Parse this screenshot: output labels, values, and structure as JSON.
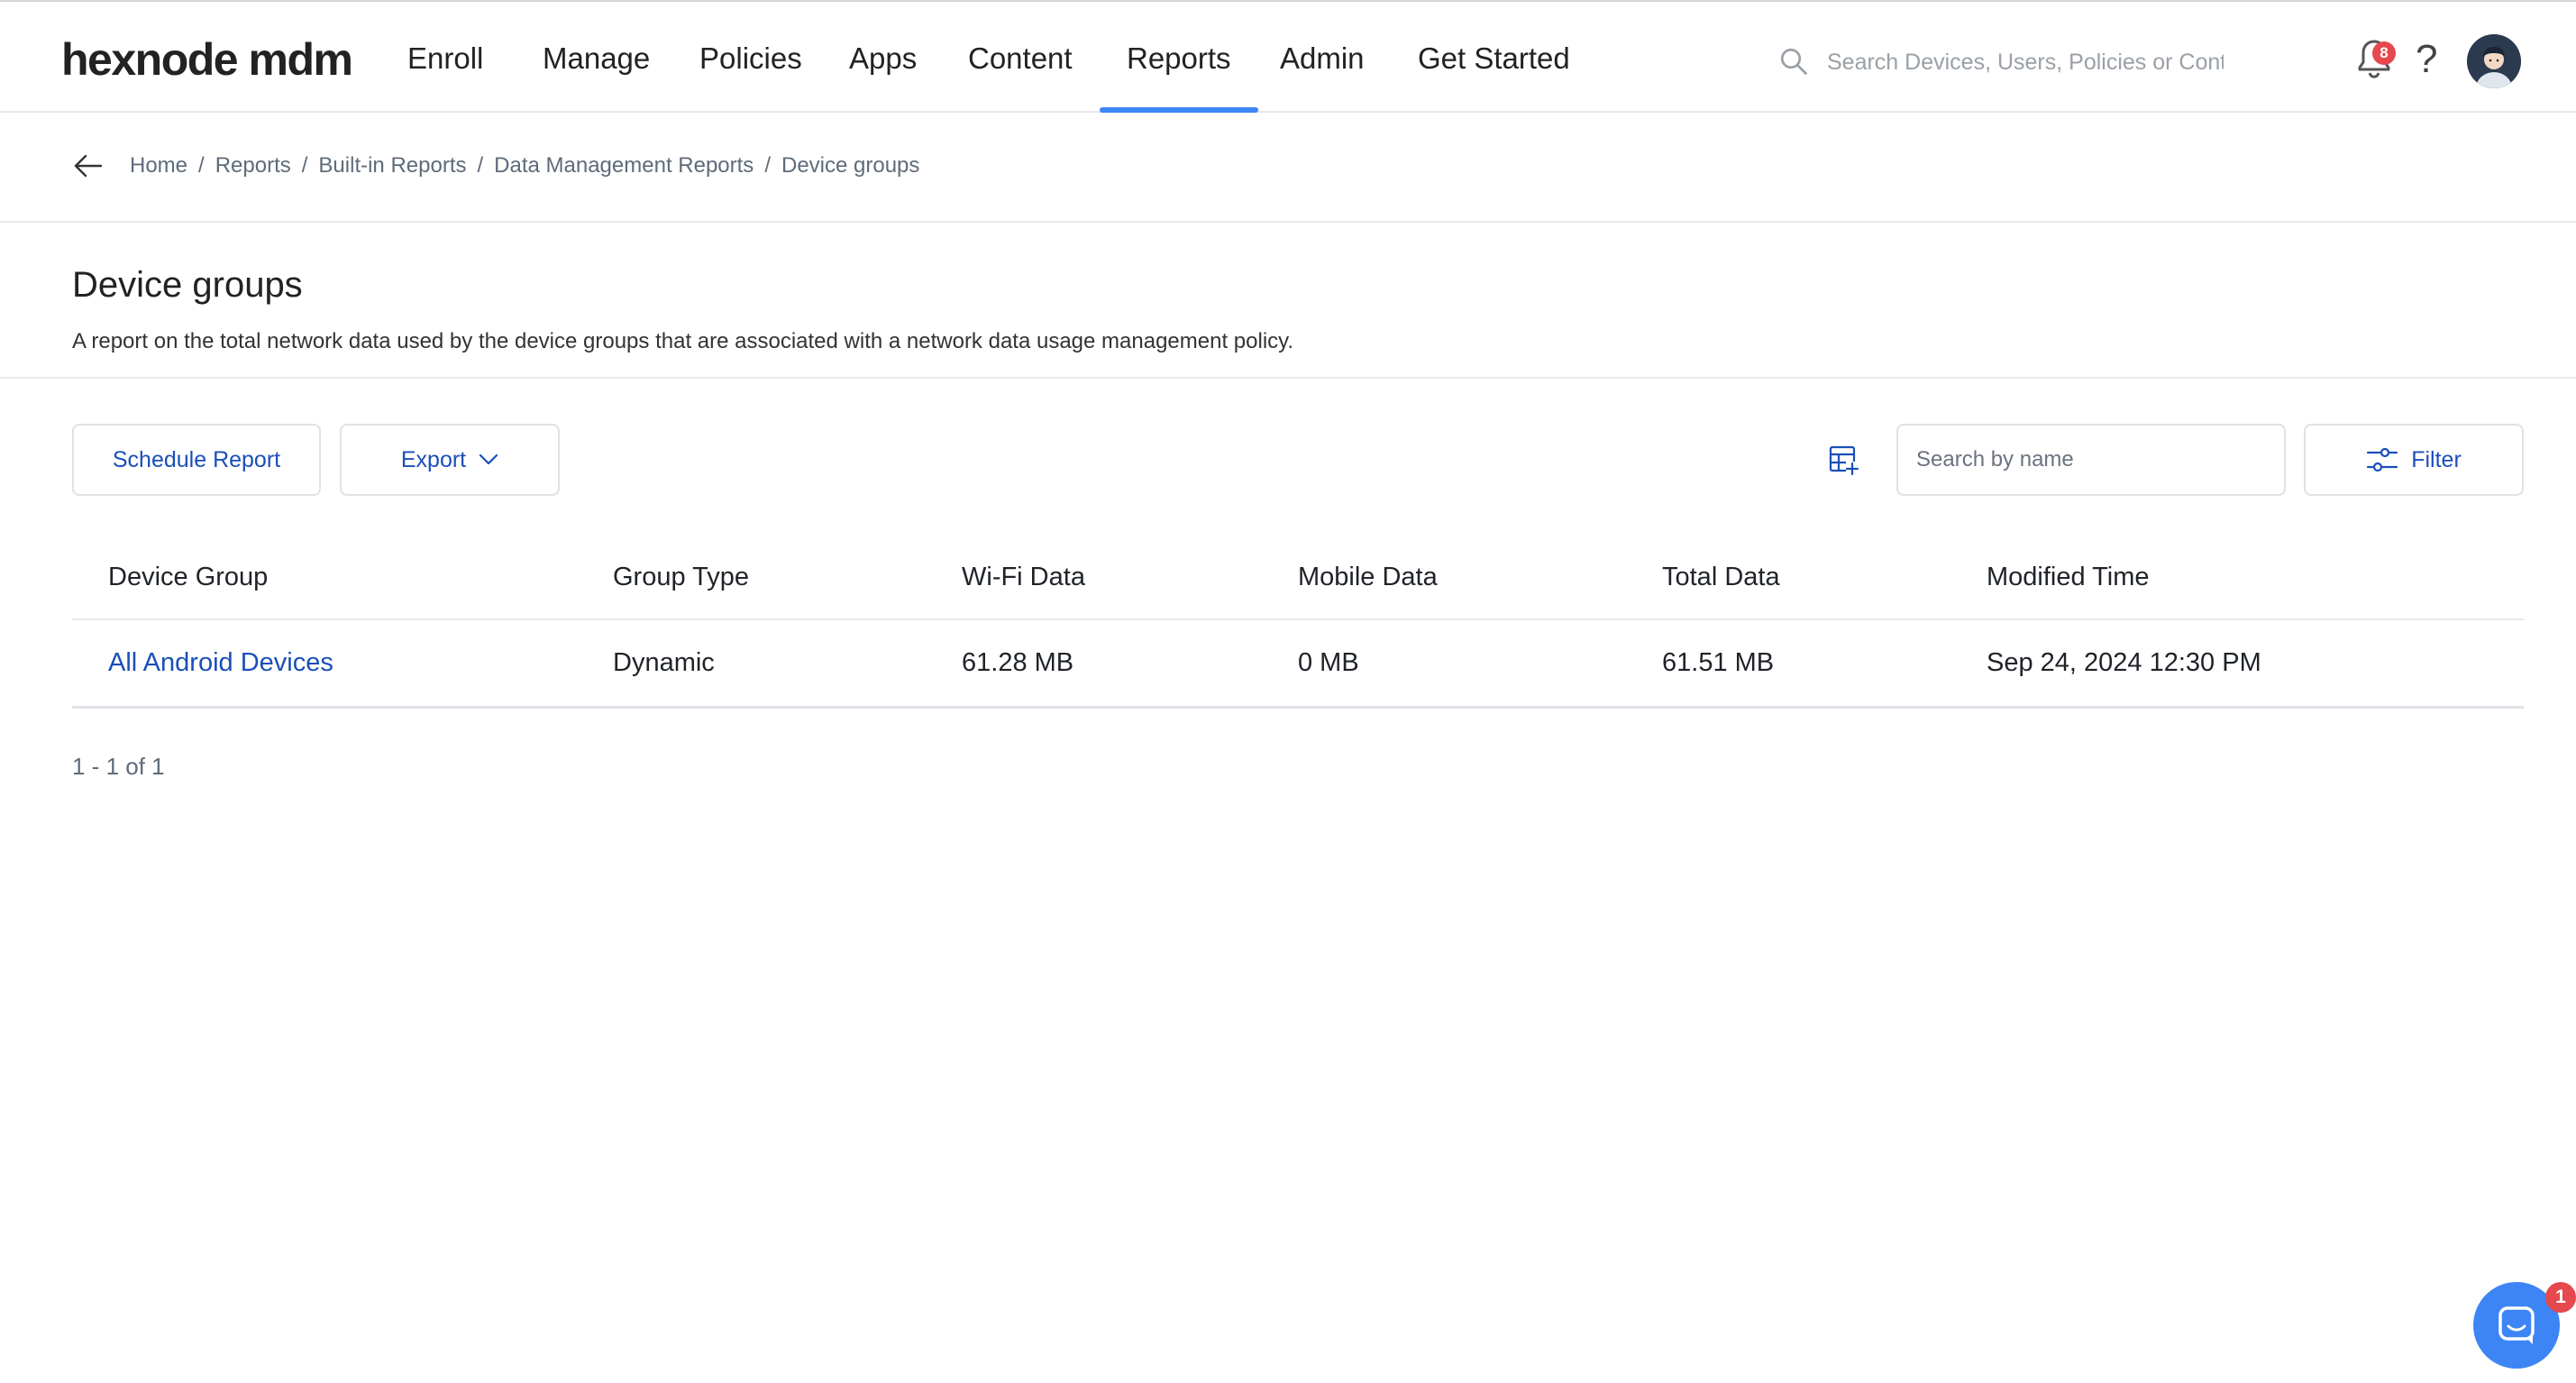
{
  "app": {
    "logo": "hexnode mdm",
    "nav": [
      "Enroll",
      "Manage",
      "Policies",
      "Apps",
      "Content",
      "Reports",
      "Admin",
      "Get Started"
    ],
    "active_nav": "Reports",
    "search_placeholder": "Search Devices, Users, Policies or Content",
    "notification_count": "8",
    "help_label": "?"
  },
  "breadcrumb": [
    "Home",
    "Reports",
    "Built-in Reports",
    "Data Management Reports",
    "Device groups"
  ],
  "page": {
    "title": "Device groups",
    "description": "A report on the total network data used by the device groups that are associated with a network data usage management policy."
  },
  "toolbar": {
    "schedule_label": "Schedule Report",
    "export_label": "Export",
    "search_placeholder": "Search by name",
    "filter_label": "Filter"
  },
  "table": {
    "columns": [
      "Device Group",
      "Group Type",
      "Wi-Fi Data",
      "Mobile Data",
      "Total Data",
      "Modified Time"
    ],
    "rows": [
      [
        "All Android Devices",
        "Dynamic",
        "61.28 MB",
        "0 MB",
        "61.51 MB",
        "Sep 24, 2024 12:30 PM"
      ]
    ]
  },
  "pagination": {
    "summary": "1 - 1 of 1"
  },
  "chat": {
    "unread_count": "1"
  },
  "colors": {
    "accent": "#3d85f5",
    "link": "#1a4fb8",
    "badge": "#e5484d"
  }
}
